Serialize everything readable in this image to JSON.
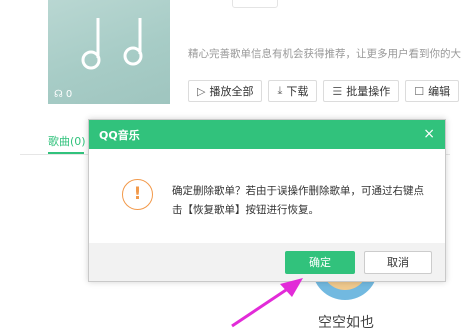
{
  "playlist": {
    "listen_count": "0",
    "description": "精心完善歌单信息有机会获得推荐，让更多用户看到你的大",
    "toolbar": [
      {
        "icon": "play-icon",
        "glyph": "▷",
        "label": "播放全部"
      },
      {
        "icon": "download-icon",
        "glyph": "⤓",
        "label": "下载"
      },
      {
        "icon": "list-icon",
        "glyph": "☰",
        "label": "批量操作"
      },
      {
        "icon": "edit-icon",
        "glyph": "☐",
        "label": "编辑"
      }
    ],
    "songs_tab": "歌曲(0)",
    "empty_text": "空空如也"
  },
  "dialog": {
    "title": "QQ音乐",
    "close_glyph": "×",
    "warning_glyph": "!",
    "message": "确定删除歌单？若由于误操作删除歌单，可通过右键点击【恢复歌单】按钮进行恢复。",
    "ok_label": "确定",
    "cancel_label": "取消"
  },
  "colors": {
    "brand_green": "#31c27c",
    "warning_orange": "#f2994a",
    "annotation_arrow": "#e22bd8"
  }
}
